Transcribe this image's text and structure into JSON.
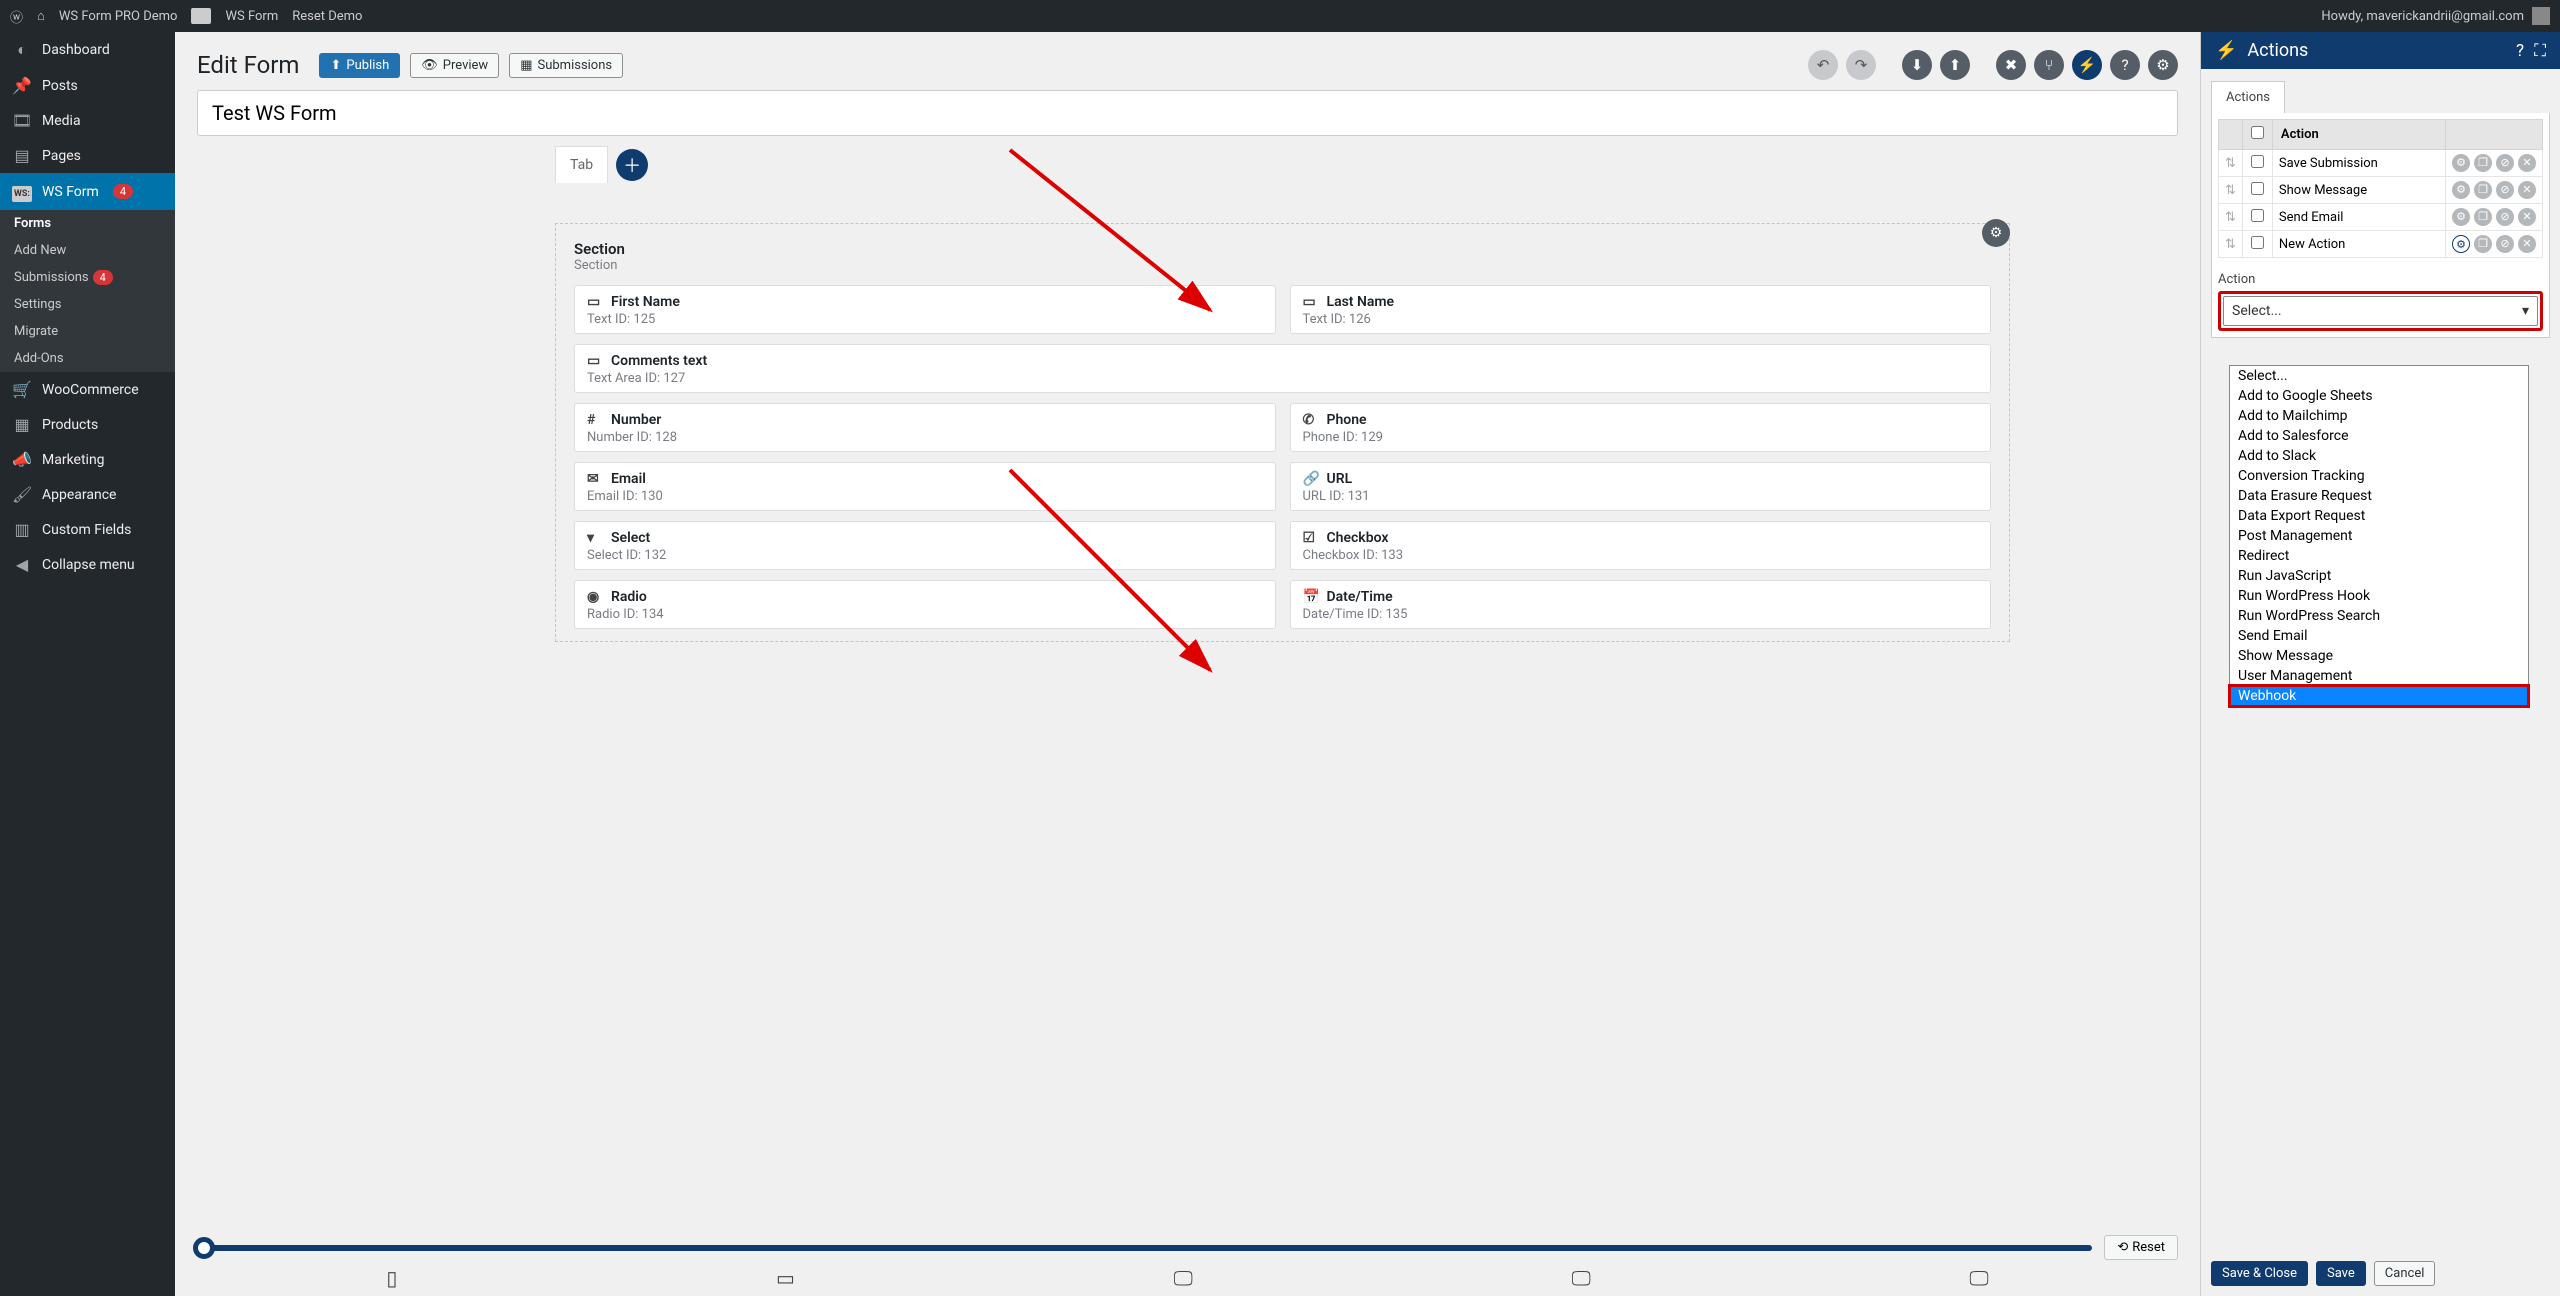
{
  "adminbar": {
    "site_name": "WS Form PRO Demo",
    "wsform_label": "WS Form",
    "reset_label": "Reset Demo",
    "howdy": "Howdy, maverickandrii@gmail.com"
  },
  "sidebar": {
    "items": [
      {
        "icon": "◐",
        "label": "Dashboard"
      },
      {
        "icon": "📌",
        "label": "Posts"
      },
      {
        "icon": "🎞",
        "label": "Media"
      },
      {
        "icon": "▤",
        "label": "Pages"
      },
      {
        "icon": "WS",
        "label": "WS Form",
        "badge": "4",
        "active": true
      },
      {
        "icon": "🛒",
        "label": "WooCommerce"
      },
      {
        "icon": "▦",
        "label": "Products"
      },
      {
        "icon": "📣",
        "label": "Marketing"
      },
      {
        "icon": "🖌",
        "label": "Appearance"
      },
      {
        "icon": "▥",
        "label": "Custom Fields"
      },
      {
        "icon": "◀",
        "label": "Collapse menu"
      }
    ],
    "subitems": [
      {
        "label": "Forms",
        "current": true
      },
      {
        "label": "Add New"
      },
      {
        "label": "Submissions",
        "badge": "4"
      },
      {
        "label": "Settings"
      },
      {
        "label": "Migrate"
      },
      {
        "label": "Add-Ons"
      }
    ]
  },
  "toolbar": {
    "title": "Edit Form",
    "publish": "Publish",
    "preview": "Preview",
    "submissions": "Submissions"
  },
  "form_name": "Test WS Form",
  "tab_label": "Tab",
  "section": {
    "title": "Section",
    "sub": "Section"
  },
  "fields": [
    {
      "icon": "▭",
      "name": "First Name",
      "sub": "Text  ID: 125"
    },
    {
      "icon": "▭",
      "name": "Last Name",
      "sub": "Text  ID: 126"
    },
    {
      "icon": "▭",
      "name": "Comments text",
      "sub": "Text Area  ID: 127",
      "full": true
    },
    {
      "icon": "#",
      "name": "Number",
      "sub": "Number  ID: 128"
    },
    {
      "icon": "✆",
      "name": "Phone",
      "sub": "Phone  ID: 129"
    },
    {
      "icon": "✉",
      "name": "Email",
      "sub": "Email  ID: 130"
    },
    {
      "icon": "🔗",
      "name": "URL",
      "sub": "URL  ID: 131"
    },
    {
      "icon": "▾",
      "name": "Select",
      "sub": "Select  ID: 132"
    },
    {
      "icon": "☑",
      "name": "Checkbox",
      "sub": "Checkbox  ID: 133"
    },
    {
      "icon": "◉",
      "name": "Radio",
      "sub": "Radio  ID: 134"
    },
    {
      "icon": "📅",
      "name": "Date/Time",
      "sub": "Date/Time  ID: 135"
    }
  ],
  "reset_btn": "Reset",
  "panel": {
    "title": "Actions",
    "tab": "Actions",
    "col_action": "Action",
    "rows": [
      {
        "label": "Save Submission",
        "blue": false
      },
      {
        "label": "Show Message",
        "blue": false
      },
      {
        "label": "Send Email",
        "blue": false
      },
      {
        "label": "New Action",
        "blue": true
      }
    ],
    "action_label": "Action",
    "select_value": "Select...",
    "options": [
      "Select...",
      "Add to Google Sheets",
      "Add to Mailchimp",
      "Add to Salesforce",
      "Add to Slack",
      "Conversion Tracking",
      "Data Erasure Request",
      "Data Export Request",
      "Post Management",
      "Redirect",
      "Run JavaScript",
      "Run WordPress Hook",
      "Run WordPress Search",
      "Send Email",
      "Show Message",
      "User Management",
      "Webhook"
    ],
    "highlight": "Webhook",
    "save_close": "Save & Close",
    "save": "Save",
    "cancel": "Cancel"
  }
}
